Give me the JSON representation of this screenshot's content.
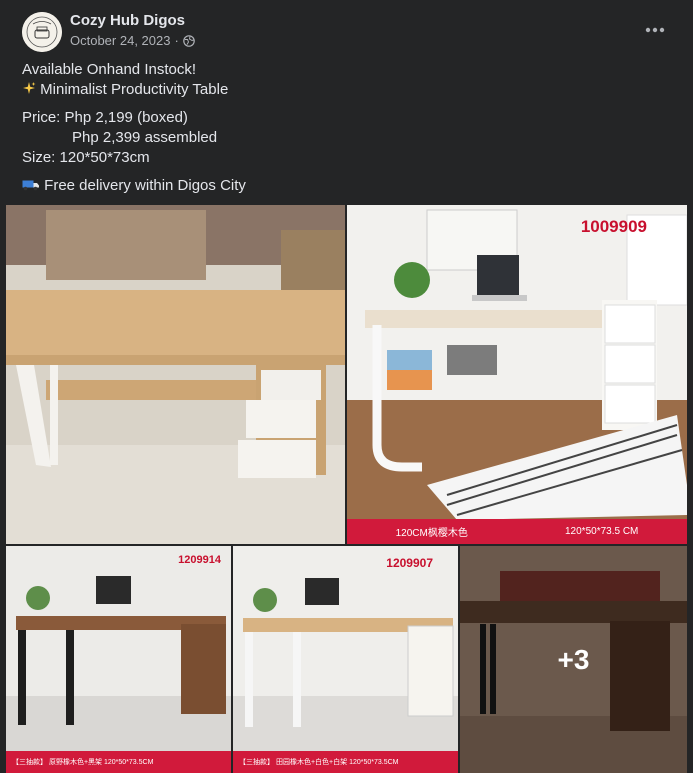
{
  "header": {
    "author": "Cozy Hub Digos",
    "date": "October 24, 2023",
    "separator": "·",
    "privacy_icon": "globe-icon",
    "more_icon": "more-options-icon",
    "avatar_icon": "page-logo"
  },
  "post": {
    "line1": "Available Onhand Instock!",
    "line2_icon": "sparkles-icon",
    "line2": " Minimalist Productivity Table",
    "line3": "Price: Php 2,199 (boxed)",
    "line4": "            Php 2,399 assembled",
    "line5": "Size: 120*50*73cm",
    "line6_icon": "truck-icon",
    "line6": " Free delivery within Digos City"
  },
  "photos": {
    "photo2_code": "1009909",
    "photo2_banner_left": "120CM枫樱木色",
    "photo2_banner_right": "120*50*73.5 CM",
    "photo3_code": "1209914",
    "photo3_banner": "【三抽款】        原野橡木色+黑架 120*50*73.5CM",
    "photo4_code": "1209907",
    "photo4_banner": "【三抽款】        田园橡木色+白色+白架 120*50*73.5CM",
    "photo5_more": "+3"
  },
  "colors": {
    "card_bg": "#242526",
    "text_primary": "#e4e6eb",
    "text_secondary": "#b0b3b8",
    "banner_red": "#d11a3b"
  }
}
